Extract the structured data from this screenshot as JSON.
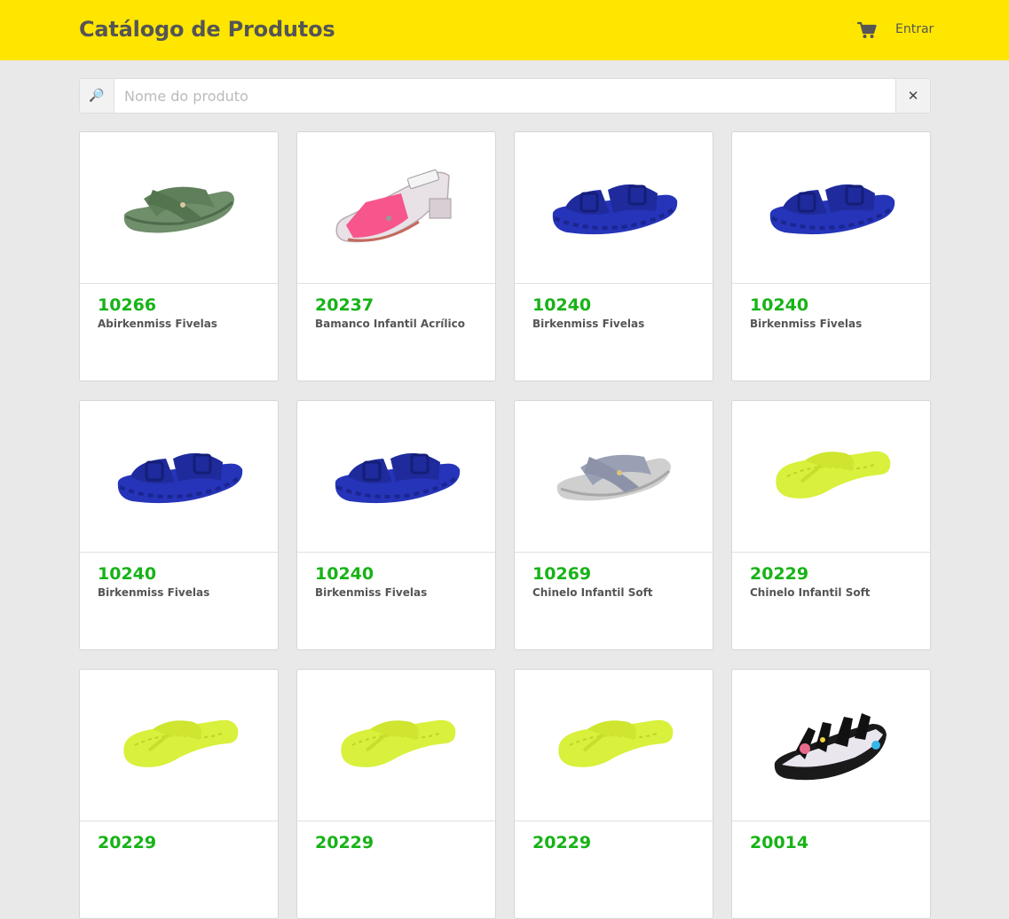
{
  "header": {
    "title": "Catálogo de Produtos",
    "login_label": "Entrar",
    "accent": "#ffe600"
  },
  "search": {
    "placeholder": "Nome do produto",
    "value": "",
    "clear_label": "✕"
  },
  "products": [
    {
      "code": "10266",
      "name": "Abirkenmiss Fivelas",
      "image": "green-cross-slide"
    },
    {
      "code": "20237",
      "name": "Bamanco Infantil Acrílico",
      "image": "pink-acrylic-heel"
    },
    {
      "code": "10240",
      "name": "Birkenmiss Fivelas",
      "image": "blue-buckle-slide"
    },
    {
      "code": "10240",
      "name": "Birkenmiss Fivelas",
      "image": "blue-buckle-slide"
    },
    {
      "code": "10240",
      "name": "Birkenmiss Fivelas",
      "image": "blue-buckle-slide"
    },
    {
      "code": "10240",
      "name": "Birkenmiss Fivelas",
      "image": "blue-buckle-slide"
    },
    {
      "code": "10269",
      "name": "Chinelo Infantil Soft",
      "image": "silver-cross-slide"
    },
    {
      "code": "20229",
      "name": "Chinelo Infantil Soft",
      "image": "lime-flipflop"
    },
    {
      "code": "20229",
      "name": "",
      "image": "lime-flipflop"
    },
    {
      "code": "20229",
      "name": "",
      "image": "lime-flipflop"
    },
    {
      "code": "20229",
      "name": "",
      "image": "lime-flipflop"
    },
    {
      "code": "20014",
      "name": "",
      "image": "black-strappy-sandal"
    }
  ],
  "colors": {
    "code": "#17b317",
    "text": "#555555"
  }
}
